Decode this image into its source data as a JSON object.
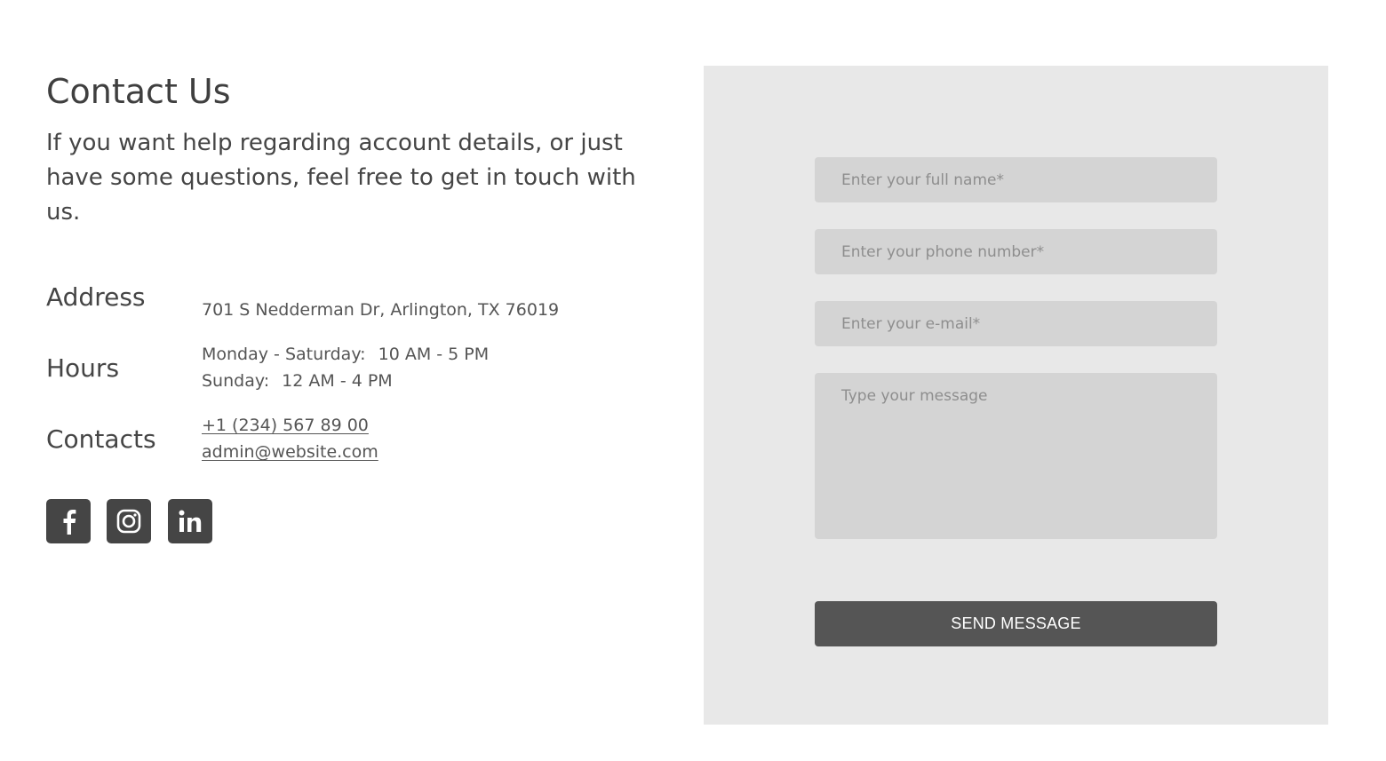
{
  "contact": {
    "title": "Contact Us",
    "intro": "If you want help regarding account details, or just have some questions, feel free to get in touch with us."
  },
  "info": {
    "address": {
      "label": "Address",
      "value": "701 S Nedderman Dr, Arlington, TX 76019"
    },
    "hours": {
      "label": "Hours",
      "lines": [
        {
          "days": "Monday - Saturday:",
          "time": "10 AM - 5 PM"
        },
        {
          "days": "Sunday:",
          "time": "12 AM - 4 PM"
        }
      ]
    },
    "contacts": {
      "label": "Contacts",
      "phone": "+1 (234) 567 89 00",
      "email": "admin@website.com"
    }
  },
  "socials": [
    {
      "name": "facebook",
      "icon": "facebook-icon"
    },
    {
      "name": "instagram",
      "icon": "instagram-icon"
    },
    {
      "name": "linkedin",
      "icon": "linkedin-icon"
    }
  ],
  "form": {
    "name_placeholder": "Enter your full name*",
    "phone_placeholder": "Enter your phone number*",
    "email_placeholder": "Enter your e-mail*",
    "message_placeholder": "Type your message",
    "submit_label": "SEND MESSAGE"
  },
  "colors": {
    "text": "#454545",
    "panel_background": "#e8e8e8",
    "field_background": "#d4d4d4",
    "button_background": "#555555",
    "social_background": "#454545"
  }
}
